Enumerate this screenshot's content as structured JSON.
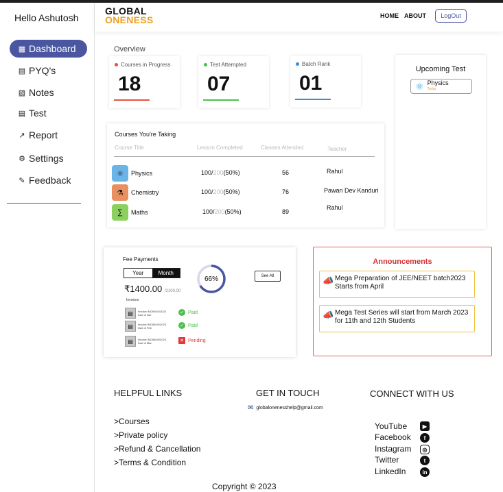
{
  "sidebar": {
    "greeting": "Hello Ashutosh",
    "items": [
      {
        "label": "Dashboard",
        "icon": "dashboard-icon",
        "glyph": "▦"
      },
      {
        "label": "PYQ's",
        "icon": "pyq-icon",
        "glyph": "▤"
      },
      {
        "label": "Notes",
        "icon": "notes-icon",
        "glyph": "▧"
      },
      {
        "label": "Test",
        "icon": "test-icon",
        "glyph": "▤"
      },
      {
        "label": "Report",
        "icon": "report-icon",
        "glyph": "↗"
      },
      {
        "label": "Settings",
        "icon": "settings-icon",
        "glyph": "⚙"
      },
      {
        "label": "Feedback",
        "icon": "feedback-icon",
        "glyph": "✎"
      }
    ]
  },
  "header": {
    "logo_line1": "GLOBAL",
    "logo_line2": "ONENESS",
    "nav_home": "HOME",
    "nav_about": "ABOUT",
    "logout": "LogOut"
  },
  "overview": {
    "label": "Overview",
    "stats": [
      {
        "label": "Courses in Progress",
        "value": "18",
        "color": "#e8503c"
      },
      {
        "label": "Test Attempted",
        "value": "07",
        "color": "#4cbf4c"
      },
      {
        "label": "Batch Rank",
        "value": "01",
        "color": "#3a8ad8"
      }
    ]
  },
  "upcoming": {
    "title": "Upcoming Test",
    "subject": "Physics",
    "sub": "Today"
  },
  "courses": {
    "title": "Courses You're Taking",
    "headers": [
      "Course Title",
      "Lesson Completed",
      "Classes Attended",
      "Teacher"
    ],
    "rows": [
      {
        "name": "Physics",
        "done": "100/",
        "total": "200",
        "pct": "(50%)",
        "attended": "56",
        "teacher": "Rahul",
        "thumb_color": "#6ab4e8",
        "glyph": "⚛"
      },
      {
        "name": "Chemistry",
        "done": "100/",
        "total": "200",
        "pct": "(50%)",
        "attended": "76",
        "teacher": "Pawan Dev Kanduri",
        "thumb_color": "#e89060",
        "glyph": "⚗"
      },
      {
        "name": "Maths",
        "done": "100/",
        "total": "200",
        "pct": "(50%)",
        "attended": "89",
        "teacher": "Rahul",
        "thumb_color": "#8cd060",
        "glyph": "∑"
      }
    ]
  },
  "fee": {
    "title": "Fee Payments",
    "toggle_year": "Year",
    "toggle_month": "Month",
    "amount": "₹1400.00",
    "amount_total": "/2100.00",
    "percent_label": "66%",
    "percent": 0.66,
    "see_all": "See All",
    "invoices_label": "Invoices",
    "invoices": [
      {
        "title": "Invoice INO09/01/2023",
        "due": "Due of Jan",
        "status": "Paid",
        "color": "#4cbf4c",
        "mark": "✓"
      },
      {
        "title": "Invoice INO05/02/2023",
        "due": "Due of Feb",
        "status": "Paid",
        "color": "#4cbf4c",
        "mark": "✓"
      },
      {
        "title": "Invoice INO08/03/2023",
        "due": "Due of Mar",
        "status": "Pending",
        "color": "#e03a3a",
        "mark": "✕"
      }
    ]
  },
  "announcements": {
    "title": "Announcements",
    "items": [
      "Mega Preparation of JEE/NEET batch2023 Starts from April",
      "Mega Test Series will start from March 2023 for 11th and 12th Students"
    ]
  },
  "footer": {
    "helpful_title": "HELPFUL LINKS",
    "links": [
      ">Courses",
      ">Private policy",
      ">Refund & Cancellation",
      ">Terms & Condition"
    ],
    "touch_title": "GET IN TOUCH",
    "email": "globalonenesshelp@gmail.com",
    "connect_title": "CONNECT WITH US",
    "socials": [
      {
        "label": "YouTube",
        "icon": "youtube-icon",
        "glyph": "▶"
      },
      {
        "label": "Facebook",
        "icon": "facebook-icon",
        "glyph": "f"
      },
      {
        "label": "Instagram",
        "icon": "instagram-icon",
        "glyph": "◎"
      },
      {
        "label": "Twitter",
        "icon": "twitter-icon",
        "glyph": "t"
      },
      {
        "label": "LinkedIn",
        "icon": "linkedin-icon",
        "glyph": "in"
      }
    ],
    "copyright": "Copyright © 2023"
  }
}
